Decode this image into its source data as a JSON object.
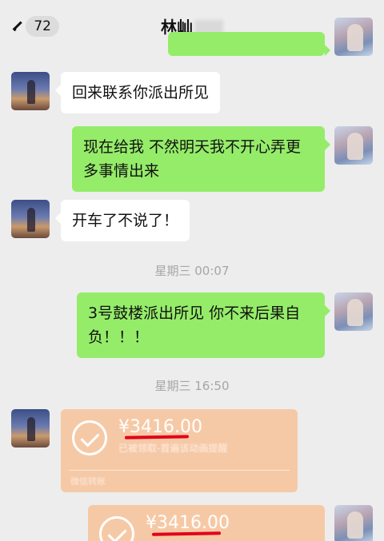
{
  "header": {
    "back_count": "72",
    "title": "林屾",
    "more_icon": "more-dots-icon"
  },
  "messages": [
    {
      "side": "left",
      "text": "回来联系你派出所见"
    },
    {
      "side": "right",
      "text": "现在给我 不然明天我不开心弄更多事情出来"
    },
    {
      "side": "left",
      "text": "开车了不说了！"
    },
    {
      "side": "right",
      "text": "3号鼓楼派出所见 你不来后果自负！！！"
    }
  ],
  "timestamps": [
    "星期三 00:07",
    "星期三 16:50"
  ],
  "transfers": [
    {
      "side": "left",
      "amount": "¥3416.00",
      "status": "已被领取-首遍该动画提醒",
      "footer": "微信转账"
    },
    {
      "side": "right",
      "amount": "¥3416.00"
    }
  ],
  "colors": {
    "background": "#ededed",
    "bubble_self": "#95ec69",
    "bubble_other": "#ffffff",
    "transfer_bg": "#f6c9a6",
    "annotation_red": "#e2001a"
  }
}
